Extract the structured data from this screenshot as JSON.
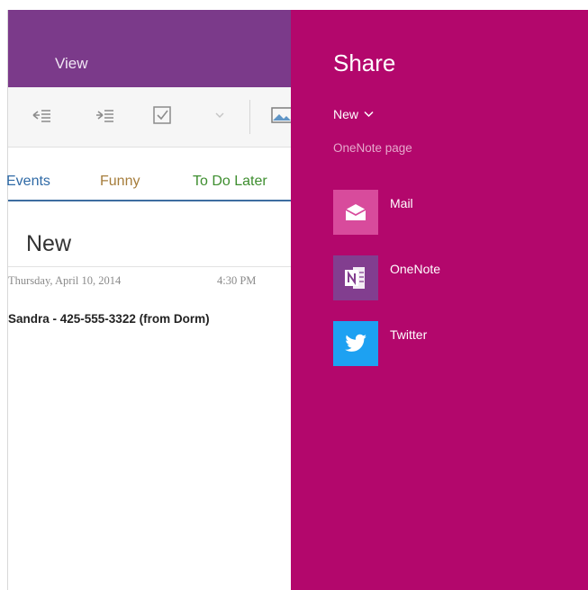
{
  "app": {
    "view_tab": "View",
    "toolbar": {
      "icons": [
        "decrease-indent-icon",
        "increase-indent-icon",
        "checkbox-icon",
        "dropdown-chevron-icon",
        "picture-icon"
      ]
    },
    "section_tabs": [
      {
        "label": "Events",
        "color": "#2f6aa6"
      },
      {
        "label": "Funny",
        "color": "#a67d3b"
      },
      {
        "label": "To Do Later",
        "color": "#3e8e2f"
      }
    ],
    "page": {
      "title": "New",
      "date": "Thursday, April 10, 2014",
      "time": "4:30 PM",
      "note_line": "Sandra - 425-555-3322 (from Dorm)"
    }
  },
  "share": {
    "title": "Share",
    "item_name": "New",
    "item_type": "OneNote page",
    "targets": [
      {
        "label": "Mail",
        "icon": "mail-icon",
        "tile_color": "#d84b9c"
      },
      {
        "label": "OneNote",
        "icon": "onenote-icon",
        "tile_color": "#823e8f"
      },
      {
        "label": "Twitter",
        "icon": "twitter-icon",
        "tile_color": "#1da1f2"
      }
    ]
  },
  "colors": {
    "share_bg": "#b3076c",
    "ribbon_bg": "#7b3a8a"
  }
}
